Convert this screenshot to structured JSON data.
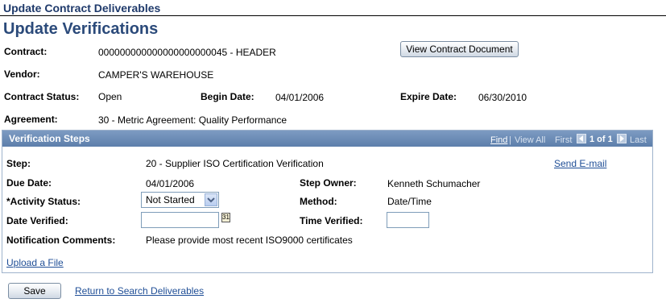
{
  "portal_title": "Update Contract Deliverables",
  "page_title": "Update Verifications",
  "header": {
    "contract_label": "Contract:",
    "contract_value": "000000000000000000000045 - HEADER",
    "view_doc_button": "View Contract Document",
    "vendor_label": "Vendor:",
    "vendor_value": "CAMPER'S WAREHOUSE",
    "status_label": "Contract Status:",
    "status_value": "Open",
    "begin_label": "Begin Date:",
    "begin_value": "04/01/2006",
    "expire_label": "Expire Date:",
    "expire_value": "06/30/2010",
    "agreement_label": "Agreement:",
    "agreement_value": "30 - Metric Agreement: Quality Performance"
  },
  "grid": {
    "title": "Verification Steps",
    "nav": {
      "find": "Find",
      "view_all": "View All",
      "first": "First",
      "range": "1 of 1",
      "last": "Last"
    },
    "step_label": "Step:",
    "step_value": "20 - Supplier ISO Certification Verification",
    "send_email": "Send E-mail",
    "due_label": "Due Date:",
    "due_value": "04/01/2006",
    "owner_label": "Step Owner:",
    "owner_value": "Kenneth Schumacher",
    "activity_label": "*Activity Status:",
    "activity_value": "Not Started",
    "method_label": "Method:",
    "method_value": "Date/Time",
    "date_verified_label": "Date Verified:",
    "date_verified_value": "",
    "time_verified_label": "Time Verified:",
    "time_verified_value": "",
    "comments_label": "Notification Comments:",
    "comments_value": "Please provide most recent ISO9000 certificates",
    "upload_link": "Upload a File"
  },
  "footer": {
    "save_button": "Save",
    "return_link": "Return to Search Deliverables"
  },
  "colors": {
    "title": "#2b4a7a",
    "grid_header": "#5d7fab",
    "link": "#1f4e96"
  },
  "icons": {
    "calendar": "calendar-icon",
    "dropdown": "chevron-down-icon",
    "prev": "arrow-left-icon",
    "next": "arrow-right-icon"
  }
}
